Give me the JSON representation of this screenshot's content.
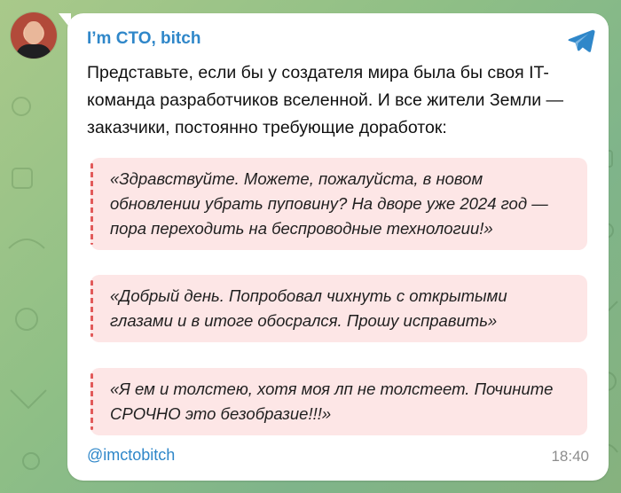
{
  "channel": {
    "name": "I’m CTO, bitch",
    "handle": "@imctobitch",
    "time": "18:40"
  },
  "message": {
    "intro": "Представьте, если бы у создателя мира была бы своя IT-команда разработчиков вселенной. И все жители Земли — заказчики, постоянно требующие доработок:",
    "quotes": [
      "«Здравствуйте. Можете, пожалуйста, в новом обновлении убрать пуповину? На дворе уже 2024 год — пора переходить на беспроводные технологии!»",
      "«Добрый день. Попробовал чихнуть с открытыми глазами и в итоге обосрался. Прошу исправить»",
      "«Я ем и толстею, хотя моя лп не толстеет. Почините СРОЧНО это безобразие!!!»"
    ]
  },
  "icons": {
    "telegram": "telegram-icon",
    "avatar": "channel-avatar"
  },
  "colors": {
    "accent": "#2f87c9",
    "quote_bg": "#fde6e6",
    "quote_bar": "#e25a5a",
    "background": "#8fbf86"
  }
}
